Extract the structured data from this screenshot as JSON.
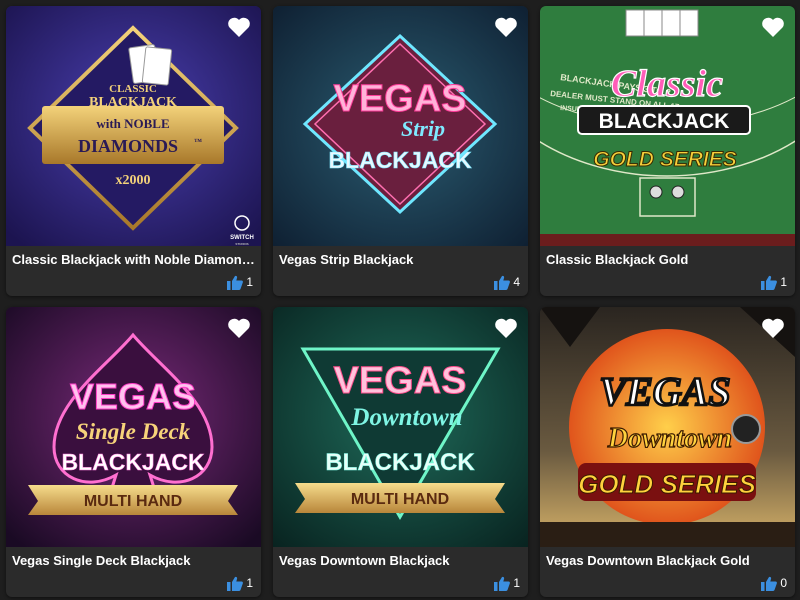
{
  "games": [
    {
      "title": "Classic Blackjack with Noble Diamonds",
      "likes": "1",
      "art": {
        "line1": "CLASSIC",
        "line2": "BLACKJACK",
        "line3": "with NOBLE",
        "line4": "DIAMONDS",
        "tm": "™",
        "multiplier": "x2000",
        "provider": "SWITCH",
        "provider_sub": "STUDIOS"
      }
    },
    {
      "title": "Vegas Strip Blackjack",
      "likes": "4",
      "art": {
        "line1": "VEGAS",
        "line2": "Strip",
        "line3": "BLACKJACK"
      }
    },
    {
      "title": "Classic Blackjack Gold",
      "likes": "1",
      "art": {
        "line1": "Classic",
        "line2": "BLACKJACK",
        "line3": "GOLD SERIES",
        "felt1": "BLACKJACK PAYS 3 TO 2",
        "felt2": "DEALER MUST STAND ON ALL 17s",
        "felt3": "INSURANCE PAYS 2 TO 1"
      }
    },
    {
      "title": "Vegas Single Deck Blackjack",
      "likes": "1",
      "art": {
        "line1": "VEGAS",
        "line2": "Single Deck",
        "line3": "BLACKJACK",
        "banner": "MULTI HAND"
      }
    },
    {
      "title": "Vegas Downtown Blackjack",
      "likes": "1",
      "art": {
        "line1": "VEGAS",
        "line2": "Downtown",
        "line3": "BLACKJACK",
        "banner": "MULTI HAND"
      }
    },
    {
      "title": "Vegas Downtown Blackjack Gold",
      "likes": "0",
      "art": {
        "line1": "VEGAS",
        "line2": "Downtown",
        "line3": "GOLD SERIES"
      }
    }
  ],
  "colors": {
    "background": "#1e1e1e",
    "card": "#2b2b2b",
    "like_icon": "#3b8fe0",
    "favorite_icon": "#ffffff"
  },
  "icons": {
    "favorite": "heart-icon",
    "like": "thumbs-up-icon"
  }
}
